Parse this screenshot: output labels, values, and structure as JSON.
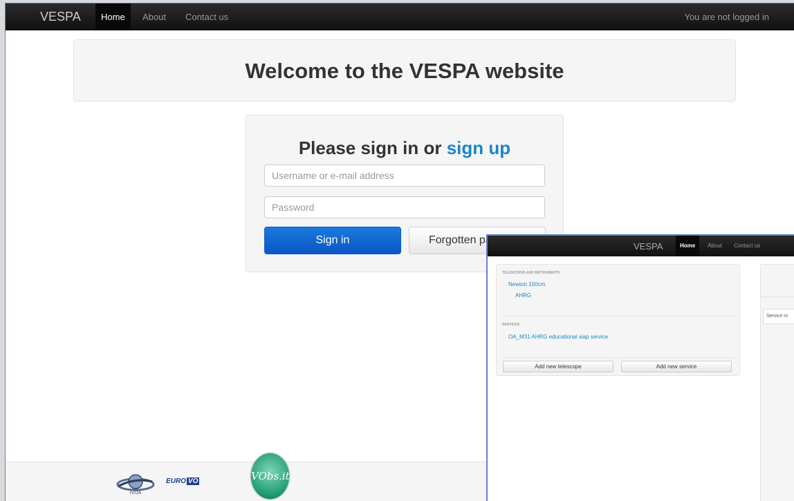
{
  "navbar": {
    "brand": "VESPA",
    "items": [
      {
        "label": "Home",
        "active": true
      },
      {
        "label": "About",
        "active": false
      },
      {
        "label": "Contact us",
        "active": false
      }
    ],
    "login_status": "You are not logged in"
  },
  "hero": {
    "title": "Welcome to the VESPA website"
  },
  "signin": {
    "title_prefix": "Please sign in or ",
    "title_link": "sign up",
    "username_placeholder": "Username or e-mail address",
    "password_placeholder": "Password",
    "signin_label": "Sign in",
    "forgot_label": "Forgotten password"
  },
  "footer": {
    "logos": {
      "ivoa": "IVOA",
      "eurovo_prefix": "EURO",
      "eurovo_suffix": "VO",
      "obs": "VObs.it"
    }
  },
  "overlay": {
    "navbar": {
      "brand": "VESPA",
      "items": [
        "Home",
        "About",
        "Contact us"
      ]
    },
    "panel": {
      "telescopes_heading": "TELESCOPES AND INSTRUMENTS",
      "telescope": "Newton 150cm",
      "instrument": "AHRG",
      "services_heading": "SERVICES",
      "service": "OA_M31 AHRG educational siap service",
      "add_telescope": "Add new telescope",
      "add_service": "Add new service"
    },
    "right_panel": {
      "tab_label": "Service m"
    }
  },
  "colors": {
    "navbar_bg": "#111111",
    "link": "#1a86c8",
    "primary_button": "#0b55c4"
  }
}
